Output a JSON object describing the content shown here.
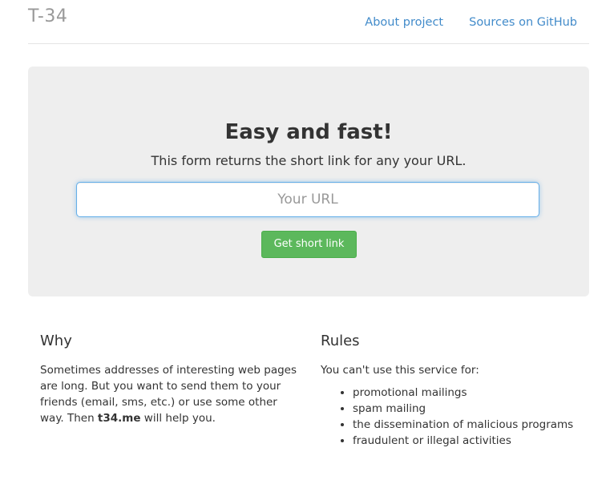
{
  "header": {
    "brand": "T-34",
    "nav": [
      {
        "label": "About project"
      },
      {
        "label": "Sources on GitHub"
      }
    ]
  },
  "hero": {
    "title": "Easy and fast!",
    "lead": "This form returns the short link for any your URL.",
    "input_placeholder": "Your URL",
    "input_value": "",
    "button_label": "Get short link"
  },
  "why": {
    "heading": "Why",
    "text_before": "Sometimes addresses of interesting web pages are long. But you want to send them to your friends (email, sms, etc.) or use some other way. Then ",
    "text_strong": "t34.me",
    "text_after": " will help you."
  },
  "rules": {
    "heading": "Rules",
    "intro": "You can't use this service for:",
    "items": [
      "promotional mailings",
      "spam mailing",
      "the dissemination of malicious programs",
      "fraudulent or illegal activities"
    ]
  },
  "colors": {
    "link": "#428bca",
    "brand_text": "#999999",
    "jumbotron_bg": "#eeeeee",
    "button_bg": "#5cb85c",
    "input_focus_border": "#66afe9"
  }
}
